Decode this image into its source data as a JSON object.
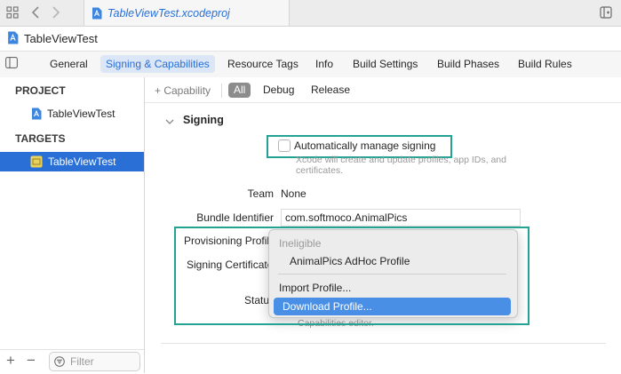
{
  "window": {
    "tab_file": "TableViewTest.xcodeproj",
    "project_title": "TableViewTest"
  },
  "editor_tabs": [
    "General",
    "Signing & Capabilities",
    "Resource Tags",
    "Info",
    "Build Settings",
    "Build Phases",
    "Build Rules"
  ],
  "sidebar": {
    "project_header": "PROJECT",
    "project_item": "TableViewTest",
    "targets_header": "TARGETS",
    "target_item": "TableViewTest",
    "filter_placeholder": "Filter"
  },
  "capability_bar": {
    "add_capability": "+ Capability",
    "filters": [
      "All",
      "Debug",
      "Release"
    ]
  },
  "signing": {
    "section_title": "Signing",
    "auto_manage_label": "Automatically manage signing",
    "auto_manage_help": "Xcode will create and update profiles, app IDs, and certificates.",
    "team_label": "Team",
    "team_value": "None",
    "bundle_id_label": "Bundle Identifier",
    "bundle_id_value": "com.softmoco.AnimalPics",
    "provisioning_label": "Provisioning Profile",
    "cert_label": "Signing Certificate",
    "status_label": "Status",
    "status_partial": "Capabilities editor."
  },
  "dropdown": {
    "ineligible": "Ineligible",
    "profile": "AnimalPics AdHoc Profile",
    "import": "Import Profile...",
    "download": "Download Profile..."
  },
  "colors": {
    "accent": "#2a6fd6",
    "highlight": "#22a393",
    "menu_highlight": "#4a8fe6"
  }
}
